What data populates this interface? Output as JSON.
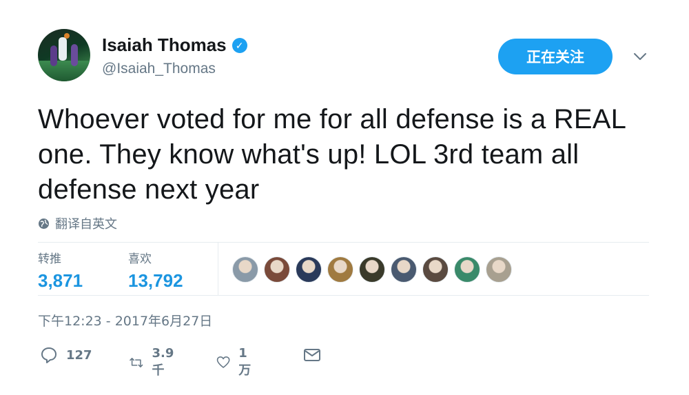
{
  "user": {
    "name": "Isaiah Thomas",
    "handle": "@Isaiah_Thomas",
    "verified_glyph": "✓"
  },
  "follow_button": {
    "label": "正在关注"
  },
  "tweet": {
    "text": "Whoever voted for me for all defense is a REAL one. They know what's up! LOL 3rd team all defense next year",
    "translate_label": "翻译自英文",
    "timestamp": "下午12:23 - 2017年6月27日"
  },
  "stats": {
    "retweets": {
      "label": "转推",
      "value": "3,871"
    },
    "likes": {
      "label": "喜欢",
      "value": "13,792"
    },
    "liker_avatars": [
      {
        "icon": "liker-avatar-1",
        "color": "#8a9aa8"
      },
      {
        "icon": "liker-avatar-2",
        "color": "#7a4a3a"
      },
      {
        "icon": "liker-avatar-3",
        "color": "#2a3a5a"
      },
      {
        "icon": "liker-avatar-4",
        "color": "#a07a40"
      },
      {
        "icon": "liker-avatar-5",
        "color": "#3a3a2a"
      },
      {
        "icon": "liker-avatar-6",
        "color": "#4a5a70"
      },
      {
        "icon": "liker-avatar-7",
        "color": "#5a4a40"
      },
      {
        "icon": "liker-avatar-8",
        "color": "#3a8a6a"
      },
      {
        "icon": "liker-avatar-9",
        "color": "#a8a090"
      }
    ]
  },
  "actions": {
    "reply_count": "127",
    "retweet_count": "3.9千",
    "like_count": "1万"
  },
  "colors": {
    "accent": "#1da1f2",
    "stat_value": "#1b95e0",
    "secondary_text": "#657786"
  }
}
